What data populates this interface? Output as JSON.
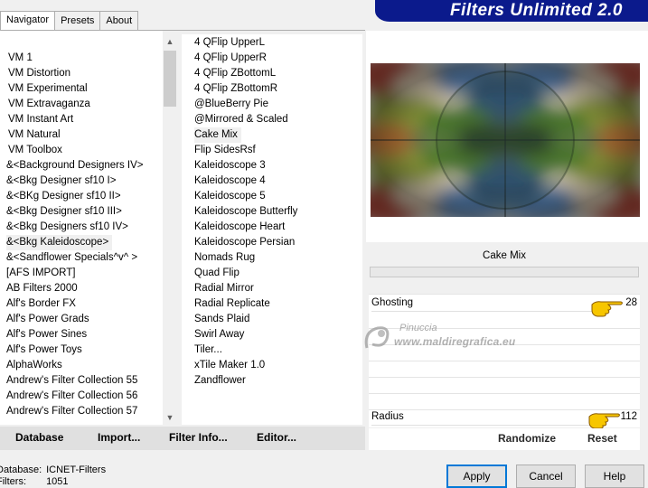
{
  "banner": {
    "title": "Filters Unlimited 2.0"
  },
  "tabs": [
    {
      "label": "Navigator",
      "active": true
    },
    {
      "label": "Presets",
      "active": false
    },
    {
      "label": "About",
      "active": false
    }
  ],
  "categories": [
    "VM 1",
    "VM Distortion",
    "VM Experimental",
    "VM Extravaganza",
    "VM Instant Art",
    "VM Natural",
    "VM Toolbox",
    "&<Background Designers IV>",
    "&<Bkg Designer sf10 I>",
    "&<BKg Designer sf10 II>",
    "&<Bkg Designer sf10 III>",
    "&<Bkg Designers sf10 IV>",
    "&<Bkg Kaleidoscope>",
    "&<Sandflower Specials^v^ >",
    "[AFS IMPORT]",
    "AB Filters 2000",
    "Alf's Border FX",
    "Alf's Power Grads",
    "Alf's Power Sines",
    "Alf's Power Toys",
    "AlphaWorks",
    "Andrew's Filter Collection 55",
    "Andrew's Filter Collection 56",
    "Andrew's Filter Collection 57"
  ],
  "selected_category": "&<Bkg Kaleidoscope>",
  "filters": [
    "4 QFlip UpperL",
    "4 QFlip UpperR",
    "4 QFlip ZBottomL",
    "4 QFlip ZBottomR",
    "@BlueBerry Pie",
    "@Mirrored & Scaled",
    "Cake Mix",
    "Flip SidesRsf",
    "Kaleidoscope 3",
    "Kaleidoscope 4",
    "Kaleidoscope 5",
    "Kaleidoscope Butterfly",
    "Kaleidoscope Heart",
    "Kaleidoscope Persian",
    "Nomads Rug",
    "Quad Flip",
    "Radial Mirror",
    "Radial Replicate",
    "Sands Plaid",
    "Swirl Away",
    "Tiler...",
    "xTile Maker 1.0",
    "Zandflower"
  ],
  "selected_filter": "Cake Mix",
  "left_buttons": {
    "database": "Database",
    "import": "Import...",
    "filter_info": "Filter Info...",
    "editor": "Editor..."
  },
  "filter_panel": {
    "name": "Cake Mix",
    "params": [
      {
        "label": "Ghosting",
        "value": "28"
      },
      {
        "label": "Radius",
        "value": "112"
      }
    ]
  },
  "right_buttons": {
    "randomize": "Randomize",
    "reset": "Reset"
  },
  "watermark": {
    "brand": "Pinuccia",
    "url": "www.maldiregrafica.eu"
  },
  "status": {
    "database_label": "Database:",
    "database_value": "ICNET-Filters",
    "filters_label": "Filters:",
    "filters_value": "1051"
  },
  "dialog": {
    "apply": "Apply",
    "cancel": "Cancel",
    "help": "Help"
  },
  "colors": {
    "banner": "#0b1a8c",
    "default_button_border": "#0078d7",
    "hand": "#f7c600"
  }
}
